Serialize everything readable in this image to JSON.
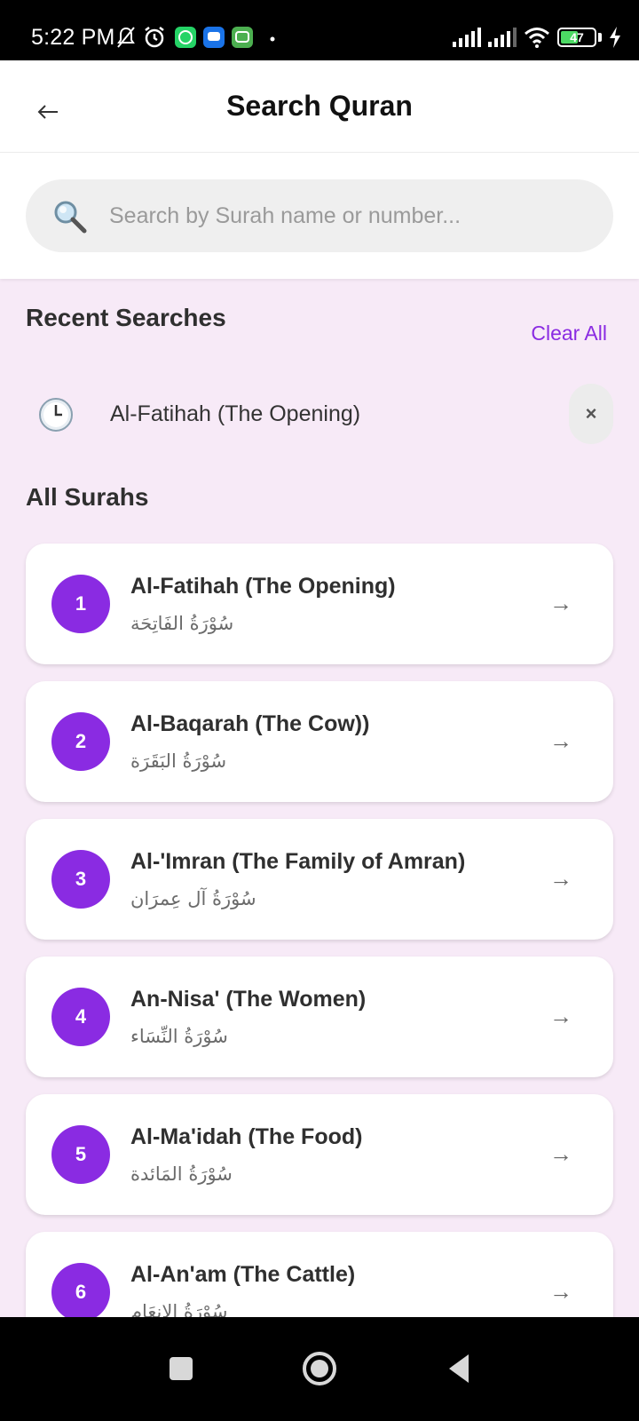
{
  "status_bar": {
    "time": "5:22 PM",
    "battery": "47",
    "icons": [
      "mute-icon",
      "alarm-icon",
      "whatsapp-icon",
      "messages-icon",
      "chat-icon",
      "dot-icon",
      "signal-icon",
      "signal-icon",
      "wifi-icon",
      "battery-icon",
      "charging-icon"
    ]
  },
  "header": {
    "title": "Search Quran",
    "back_icon": "arrow-left-icon"
  },
  "search": {
    "placeholder": "Search by Surah name or number...",
    "value": "",
    "icon": "search-icon"
  },
  "recent": {
    "title": "Recent Searches",
    "clear_label": "Clear All",
    "items": [
      {
        "label": "Al-Fatihah (The Opening)",
        "remove": "×"
      }
    ]
  },
  "surahs": {
    "title": "All Surahs",
    "items": [
      {
        "number": "1",
        "name": "Al-Fatihah (The Opening)",
        "arabic": "سُوْرَةُ الفَاتِحَة"
      },
      {
        "number": "2",
        "name": "Al-Baqarah (The Cow))",
        "arabic": "سُوْرَةُ البَقَرَة"
      },
      {
        "number": "3",
        "name": "Al-'Imran (The Family of Amran)",
        "arabic": "سُوْرَةُ آل عِمرَان"
      },
      {
        "number": "4",
        "name": "An-Nisa' (The Women)",
        "arabic": "سُوْرَةُ النِّسَاء"
      },
      {
        "number": "5",
        "name": "Al-Ma'idah (The Food)",
        "arabic": "سُوْرَةُ المَائدة"
      },
      {
        "number": "6",
        "name": "Al-An'am (The Cattle)",
        "arabic": "سُوْرَةُ الانعَام"
      }
    ],
    "arrow": "→"
  },
  "colors": {
    "accent": "#8a2be2",
    "background": "#f7eaf7"
  }
}
